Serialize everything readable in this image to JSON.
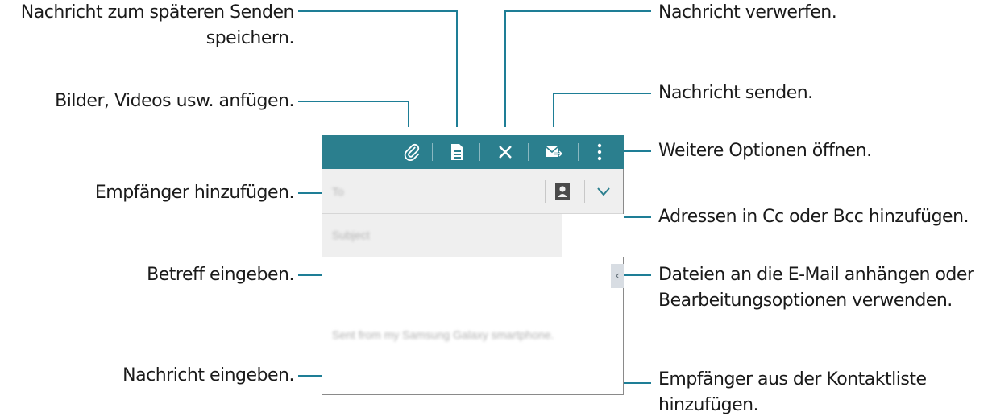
{
  "callouts": {
    "save_draft": [
      "Nachricht zum späteren Senden",
      "speichern."
    ],
    "attach": "Bilder, Videos usw. anfügen.",
    "add_recipients": "Empfänger hinzufügen.",
    "enter_subject": "Betreff eingeben.",
    "enter_message": "Nachricht eingeben.",
    "discard": "Nachricht verwerfen.",
    "send": "Nachricht senden.",
    "more_options": "Weitere Optionen öffnen.",
    "cc_bcc": "Adressen in Cc oder Bcc hinzufügen.",
    "attach_files": [
      "Dateien an die E-Mail anhängen oder",
      "Bearbeitungsoptionen verwenden."
    ],
    "contacts": [
      "Empfänger aus der Kontaktliste",
      "hinzufügen."
    ]
  },
  "phone": {
    "colors": {
      "toolbar": "#2b7f8e",
      "field_bg": "#efefef"
    },
    "toolbar_icons": [
      "paperclip-icon",
      "save-draft-icon",
      "close-icon",
      "send-mail-icon",
      "more-vert-icon"
    ],
    "to_placeholder": "To",
    "subject_placeholder": "Subject",
    "signature": "Sent from my Samsung Galaxy smartphone."
  }
}
